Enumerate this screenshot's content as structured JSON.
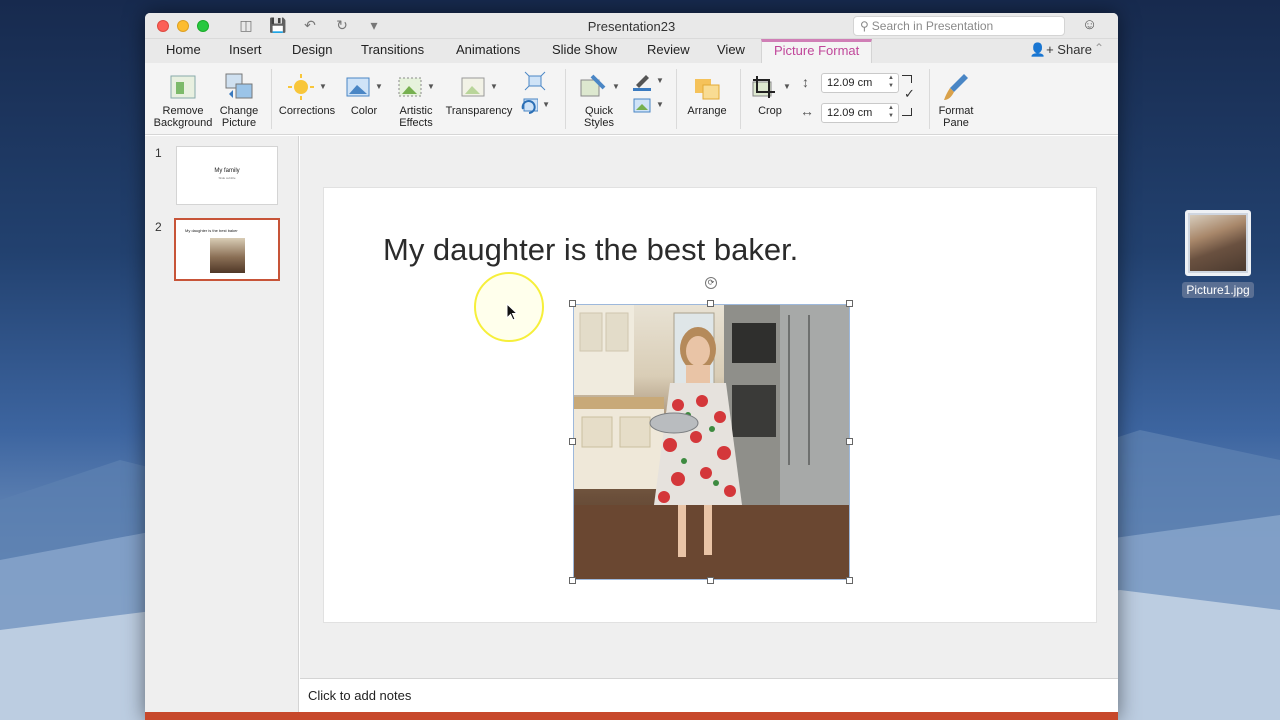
{
  "window": {
    "title": "Presentation23",
    "search_placeholder": "Search in Presentation",
    "share_label": "Share"
  },
  "tabs": [
    {
      "label": "Home"
    },
    {
      "label": "Insert"
    },
    {
      "label": "Design"
    },
    {
      "label": "Transitions"
    },
    {
      "label": "Animations"
    },
    {
      "label": "Slide Show"
    },
    {
      "label": "Review"
    },
    {
      "label": "View"
    },
    {
      "label": "Picture Format",
      "active": true
    }
  ],
  "ribbon": {
    "remove_background": "Remove Background",
    "change_picture": "Change Picture",
    "corrections": "Corrections",
    "color": "Color",
    "artistic_effects": "Artistic Effects",
    "transparency": "Transparency",
    "quick_styles": "Quick Styles",
    "arrange": "Arrange",
    "crop": "Crop",
    "height_value": "12.09 cm",
    "width_value": "12.09 cm",
    "format_pane": "Format Pane"
  },
  "slides": [
    {
      "number": "1",
      "thumb_title": "My family",
      "thumb_sub": "Slide subtitle"
    },
    {
      "number": "2",
      "thumb_title": "My daughter is the best baker",
      "selected": true
    }
  ],
  "slide": {
    "title": "My daughter is the best baker."
  },
  "notes": {
    "placeholder": "Click to add notes"
  },
  "desktop": {
    "file_name": "Picture1.jpg"
  },
  "colors": {
    "accent_tab": "#c0469a",
    "slide_selection": "#c75438",
    "status_bar": "#c7482b",
    "cursor_highlight": "#f6ef3a"
  }
}
